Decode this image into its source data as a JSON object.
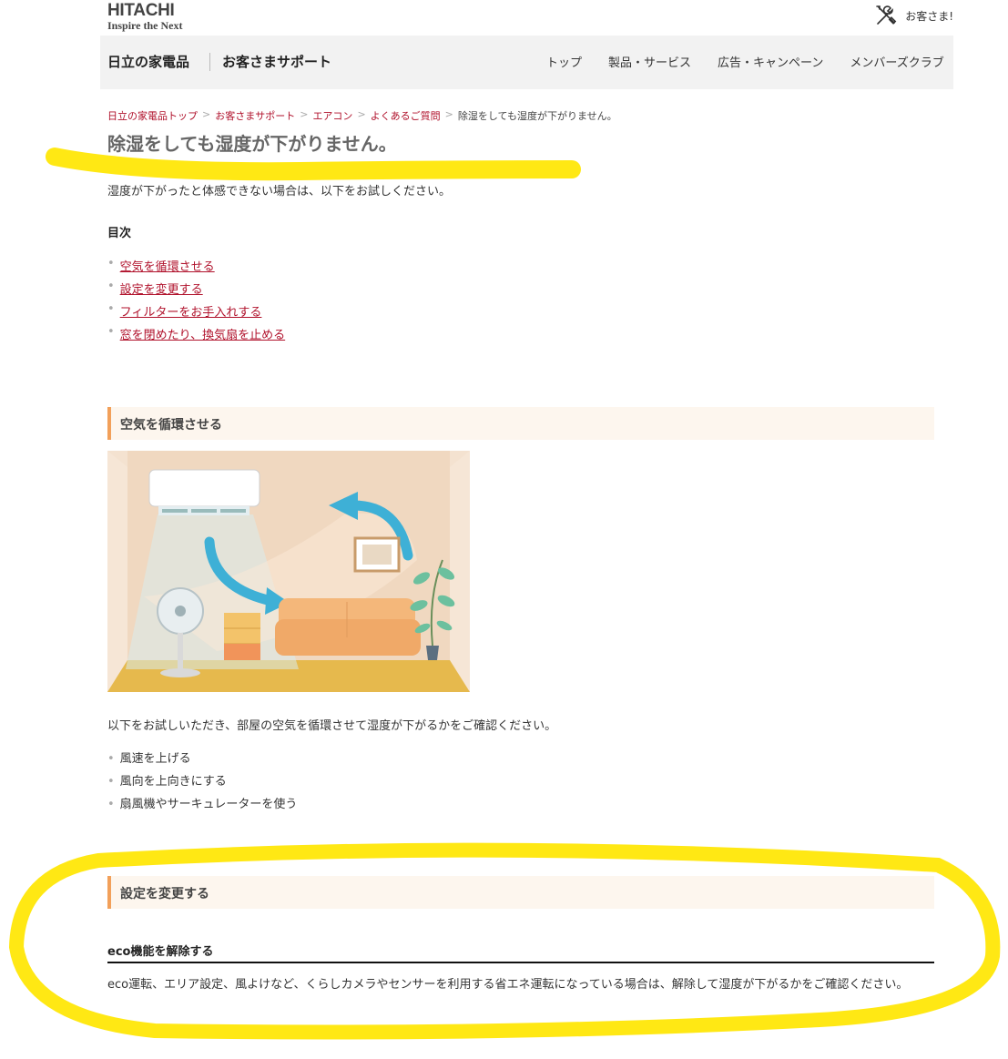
{
  "header": {
    "logo_main": "HITACHI",
    "logo_sub": "Inspire the Next",
    "support_label": "お客さま!"
  },
  "nav": {
    "site_title": "日立の家電品",
    "site_sub": "お客さまサポート",
    "links": [
      "トップ",
      "製品・サービス",
      "広告・キャンペーン",
      "メンバーズクラブ"
    ]
  },
  "breadcrumb": {
    "items": [
      "日立の家電品トップ",
      "お客さまサポート",
      "エアコン",
      "よくあるご質問"
    ],
    "separator": ">",
    "current": "除湿をしても湿度が下がりません。"
  },
  "page": {
    "title": "除湿をしても湿度が下がりません。",
    "intro": "湿度が下がったと体感できない場合は、以下をお試しください。"
  },
  "toc": {
    "title": "目次",
    "bullet": "•",
    "items": [
      "空気を循環させる",
      "設定を変更する",
      "フィルターをお手入れする",
      "窓を閉めたり、換気扇を止める"
    ]
  },
  "section1": {
    "title": "空気を循環させる",
    "description": "以下をお試しいただき、部屋の空気を循環させて湿度が下がるかをご確認ください。",
    "items": [
      "風速を上げる",
      "風向を上向きにする",
      "扇風機やサーキュレーターを使う"
    ]
  },
  "section2": {
    "title": "設定を変更する",
    "subheading": "eco機能を解除する",
    "description": "eco運転、エリア設定、風よけなど、くらしカメラやセンサーを利用する省エネ運転になっている場合は、解除して湿度が下がるかをご確認ください。"
  },
  "icons": {
    "support": "tools-icon"
  },
  "colors": {
    "link": "#b0112b",
    "accent": "#f2a05a",
    "section_bg": "#fdf6ee",
    "nav_bg": "#f2f2f2",
    "highlight": "#ffe600"
  }
}
